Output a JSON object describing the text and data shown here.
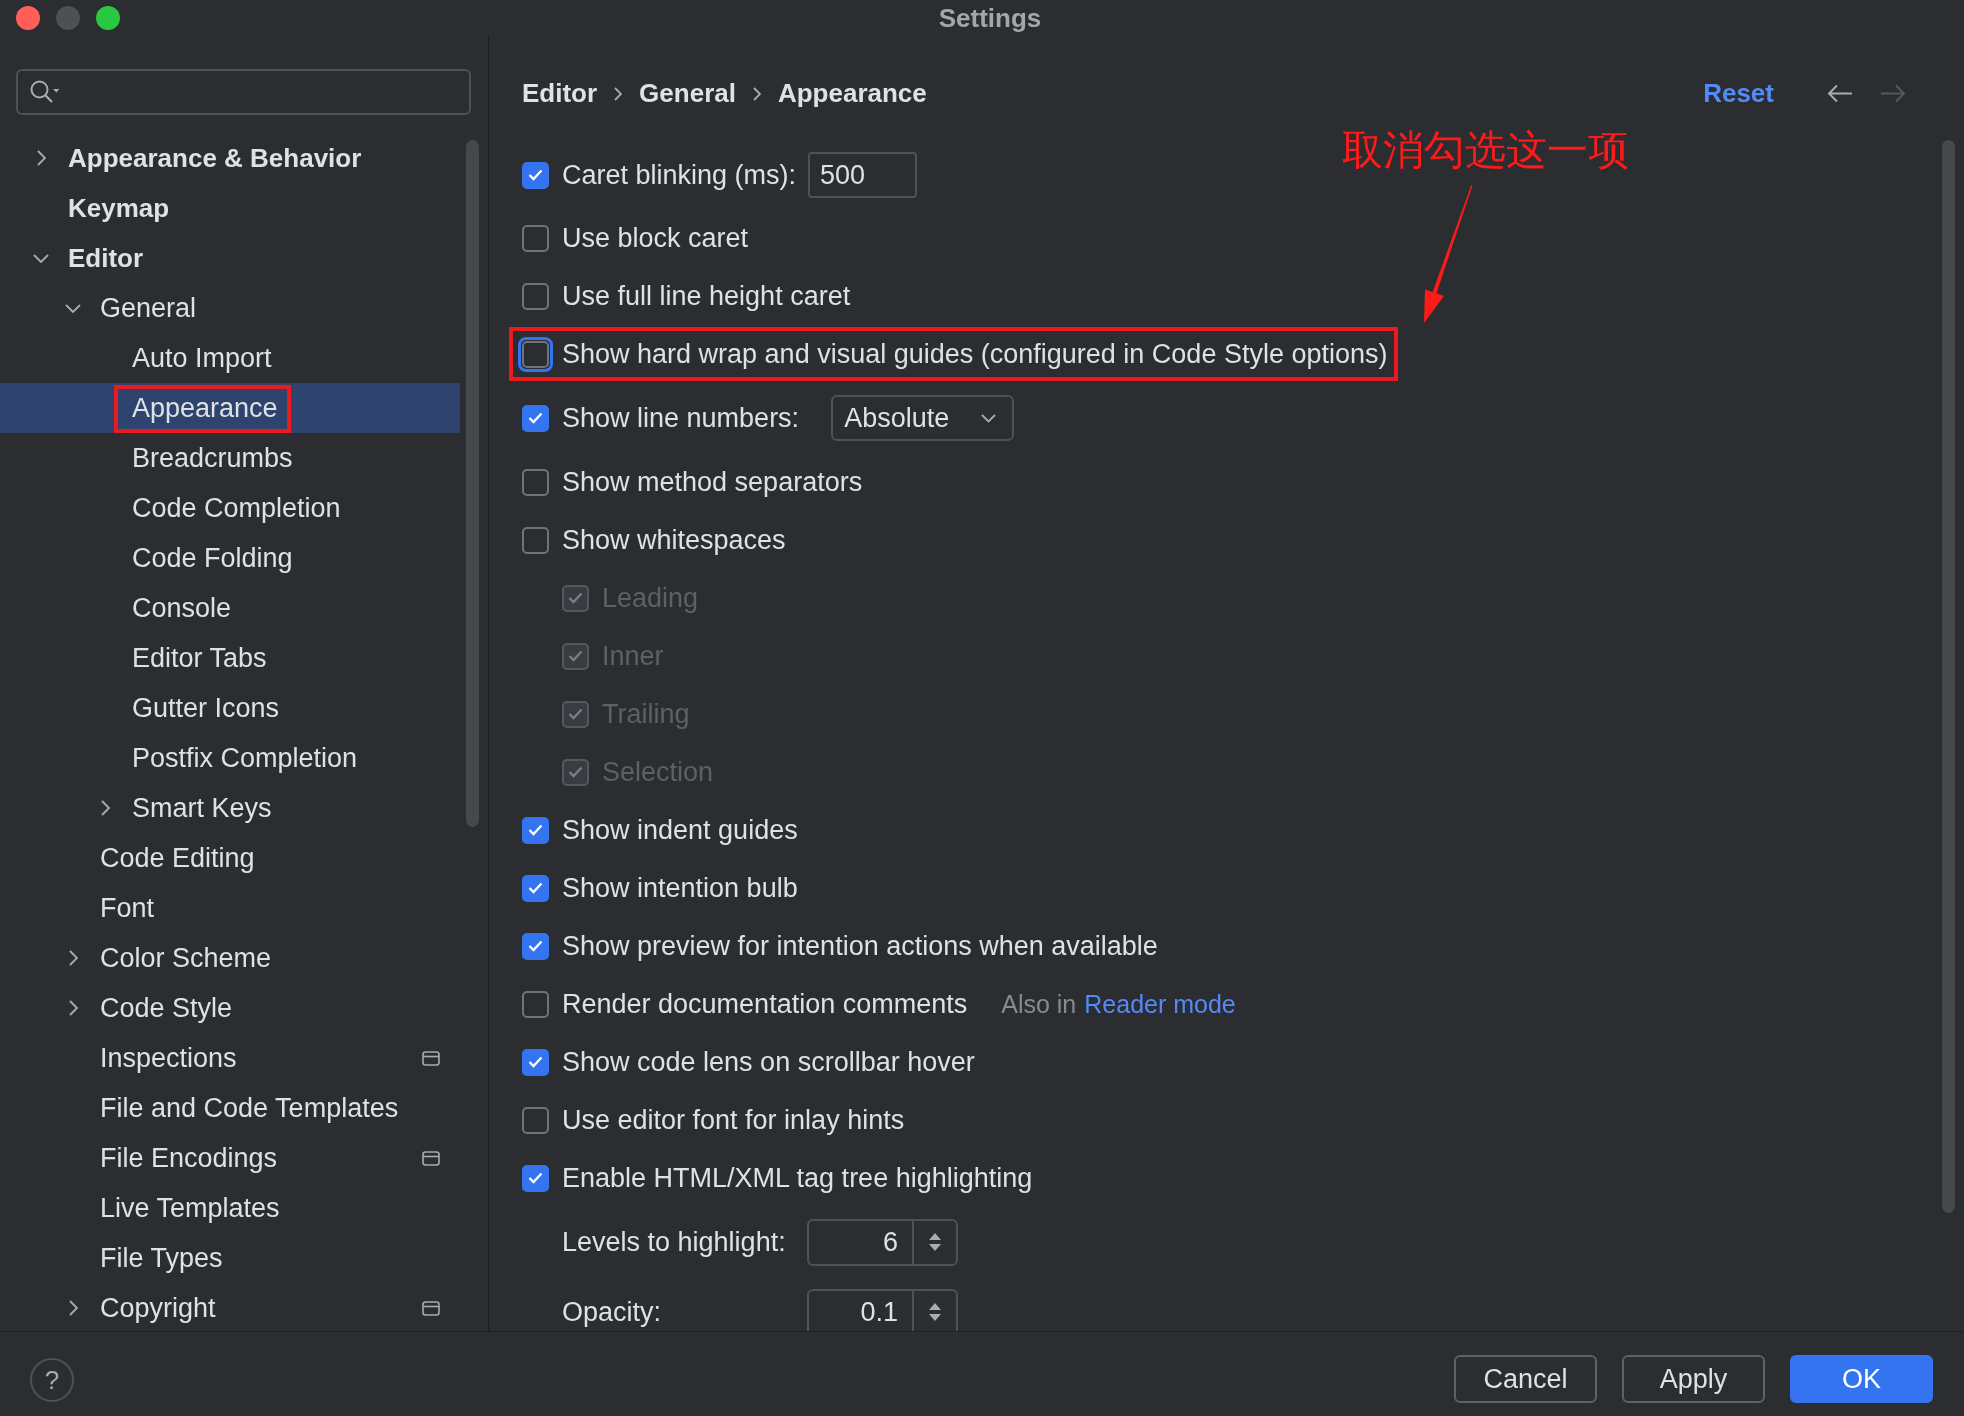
{
  "window": {
    "title": "Settings",
    "buttons": [
      {
        "color": "#ff5f57"
      },
      {
        "color": "#4f5053"
      },
      {
        "color": "#28c840"
      }
    ]
  },
  "sidebar": {
    "tree": [
      {
        "label": "Appearance & Behavior",
        "expanded": false,
        "selected": false,
        "highlighted": false,
        "project_scope": false
      },
      {
        "label": "Keymap",
        "selected": false,
        "highlighted": false,
        "project_scope": false
      },
      {
        "label": "Editor",
        "expanded": true,
        "selected": false,
        "highlighted": false,
        "project_scope": false,
        "children": [
          {
            "label": "General",
            "expanded": true,
            "selected": false,
            "highlighted": false,
            "project_scope": false,
            "children": [
              {
                "label": "Auto Import",
                "selected": false,
                "highlighted": false,
                "project_scope": false
              },
              {
                "label": "Appearance",
                "selected": true,
                "highlighted": true,
                "project_scope": false
              },
              {
                "label": "Breadcrumbs",
                "selected": false,
                "highlighted": false,
                "project_scope": false
              },
              {
                "label": "Code Completion",
                "selected": false,
                "highlighted": false,
                "project_scope": false
              },
              {
                "label": "Code Folding",
                "selected": false,
                "highlighted": false,
                "project_scope": false
              },
              {
                "label": "Console",
                "selected": false,
                "highlighted": false,
                "project_scope": false
              },
              {
                "label": "Editor Tabs",
                "selected": false,
                "highlighted": false,
                "project_scope": false
              },
              {
                "label": "Gutter Icons",
                "selected": false,
                "highlighted": false,
                "project_scope": false
              },
              {
                "label": "Postfix Completion",
                "selected": false,
                "highlighted": false,
                "project_scope": false
              },
              {
                "label": "Smart Keys",
                "expanded": false,
                "selected": false,
                "highlighted": false,
                "project_scope": false
              }
            ]
          },
          {
            "label": "Code Editing",
            "selected": false,
            "highlighted": false,
            "project_scope": false
          },
          {
            "label": "Font",
            "selected": false,
            "highlighted": false,
            "project_scope": false
          },
          {
            "label": "Color Scheme",
            "expanded": false,
            "selected": false,
            "highlighted": false,
            "project_scope": false
          },
          {
            "label": "Code Style",
            "expanded": false,
            "selected": false,
            "highlighted": false,
            "project_scope": false
          },
          {
            "label": "Inspections",
            "selected": false,
            "highlighted": false,
            "project_scope": true
          },
          {
            "label": "File and Code Templates",
            "selected": false,
            "highlighted": false,
            "project_scope": false
          },
          {
            "label": "File Encodings",
            "selected": false,
            "highlighted": false,
            "project_scope": true
          },
          {
            "label": "Live Templates",
            "selected": false,
            "highlighted": false,
            "project_scope": false
          },
          {
            "label": "File Types",
            "selected": false,
            "highlighted": false,
            "project_scope": false
          },
          {
            "label": "Copyright",
            "expanded": false,
            "selected": false,
            "highlighted": false,
            "project_scope": true
          }
        ]
      }
    ]
  },
  "content": {
    "breadcrumbs": [
      "Editor",
      "General",
      "Appearance"
    ],
    "reset": "Reset",
    "navigation": [
      {
        "kind": "back",
        "disabled": false
      },
      {
        "kind": "forward",
        "disabled": true
      }
    ],
    "settings": [
      {
        "kind": "checkbox_input",
        "label": "Caret blinking (ms):",
        "checked": true,
        "disabled": false,
        "focused": false,
        "highlighted": false,
        "value": "500"
      },
      {
        "kind": "checkbox",
        "label": "Use block caret",
        "checked": false,
        "disabled": false,
        "focused": false,
        "highlighted": false
      },
      {
        "kind": "checkbox",
        "label": "Use full line height caret",
        "checked": false,
        "disabled": false,
        "focused": false,
        "highlighted": false
      },
      {
        "kind": "checkbox",
        "label": "Show hard wrap and visual guides (configured in Code Style options)",
        "checked": false,
        "disabled": false,
        "focused": true,
        "highlighted": true
      },
      {
        "kind": "checkbox_select",
        "label": "Show line numbers:",
        "checked": true,
        "disabled": false,
        "focused": false,
        "highlighted": false,
        "value": "Absolute"
      },
      {
        "kind": "checkbox",
        "label": "Show method separators",
        "checked": false,
        "disabled": false,
        "focused": false,
        "highlighted": false
      },
      {
        "kind": "checkbox",
        "label": "Show whitespaces",
        "checked": false,
        "disabled": false,
        "focused": false,
        "highlighted": false,
        "children": [
          {
            "kind": "checkbox",
            "label": "Leading",
            "checked": true,
            "disabled": true,
            "focused": false,
            "highlighted": false
          },
          {
            "kind": "checkbox",
            "label": "Inner",
            "checked": true,
            "disabled": true,
            "focused": false,
            "highlighted": false
          },
          {
            "kind": "checkbox",
            "label": "Trailing",
            "checked": true,
            "disabled": true,
            "focused": false,
            "highlighted": false
          },
          {
            "kind": "checkbox",
            "label": "Selection",
            "checked": true,
            "disabled": true,
            "focused": false,
            "highlighted": false
          }
        ]
      },
      {
        "kind": "checkbox",
        "label": "Show indent guides",
        "checked": true,
        "disabled": false,
        "focused": false,
        "highlighted": false
      },
      {
        "kind": "checkbox",
        "label": "Show intention bulb",
        "checked": true,
        "disabled": false,
        "focused": false,
        "highlighted": false
      },
      {
        "kind": "checkbox",
        "label": "Show preview for intention actions when available",
        "checked": true,
        "disabled": false,
        "focused": false,
        "highlighted": false
      },
      {
        "kind": "checkbox_note",
        "label": "Render documentation comments",
        "checked": false,
        "disabled": false,
        "focused": false,
        "highlighted": false,
        "note": "Also in",
        "link": "Reader mode"
      },
      {
        "kind": "checkbox",
        "label": "Show code lens on scrollbar hover",
        "checked": true,
        "disabled": false,
        "focused": false,
        "highlighted": false
      },
      {
        "kind": "checkbox",
        "label": "Use editor font for inlay hints",
        "checked": false,
        "disabled": false,
        "focused": false,
        "highlighted": false
      },
      {
        "kind": "checkbox",
        "label": "Enable HTML/XML tag tree highlighting",
        "checked": true,
        "disabled": false,
        "focused": false,
        "highlighted": false,
        "children": [
          {
            "kind": "spinner",
            "label": "Levels to highlight:",
            "value": "6",
            "disabled": false,
            "highlighted": false
          },
          {
            "kind": "spinner",
            "label": "Opacity:",
            "value": "0.1",
            "disabled": false,
            "highlighted": false
          }
        ]
      }
    ]
  },
  "annotation": {
    "text": "取消勾选这一项"
  },
  "footer": {
    "help": "?",
    "buttons": [
      {
        "label": "Cancel",
        "default": false
      },
      {
        "label": "Apply",
        "default": false
      },
      {
        "label": "OK",
        "default": true
      }
    ]
  }
}
